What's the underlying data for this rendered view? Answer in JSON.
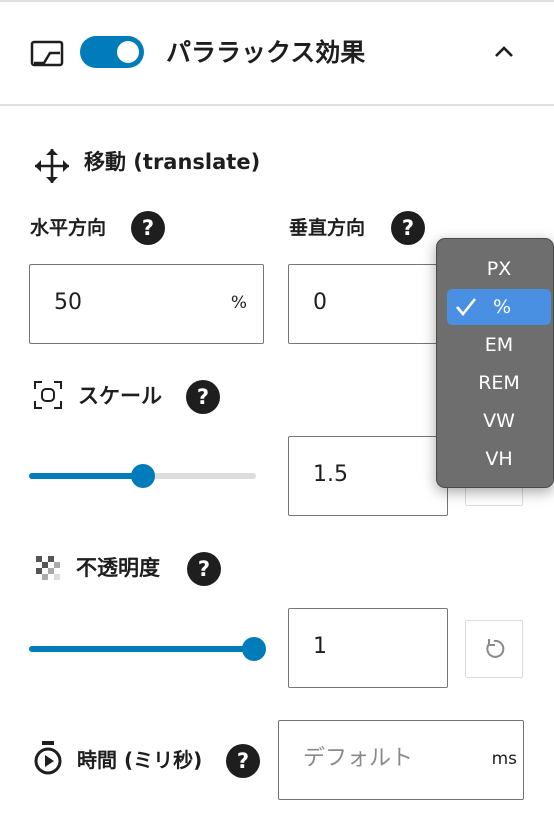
{
  "header": {
    "title": "パララックス効果",
    "toggle_on": true
  },
  "translate": {
    "title": "移動 (translate)",
    "horizontal": {
      "label": "水平方向",
      "value": "50",
      "unit": "%"
    },
    "vertical": {
      "label": "垂直方向",
      "value": "0"
    },
    "help_symbol": "?"
  },
  "unit_menu": {
    "options": [
      "PX",
      "%",
      "EM",
      "REM",
      "VW",
      "VH"
    ],
    "selected": "%"
  },
  "scale": {
    "label": "スケール",
    "value": "1.5",
    "slider_fraction": 0.5
  },
  "opacity": {
    "label": "不透明度",
    "value": "1",
    "slider_fraction": 1.0
  },
  "duration": {
    "label": "時間 (ミリ秒)",
    "placeholder": "デフォルト",
    "unit": "ms"
  },
  "colors": {
    "accent": "#007cba",
    "menu_bg": "#6e6e6e",
    "menu_selected": "#4a90e2"
  },
  "icons": [
    "panel-icon",
    "move-icon",
    "scale-icon",
    "opacity-icon",
    "stopwatch-icon",
    "chevron-up-icon",
    "reset-icon",
    "checkmark-icon"
  ]
}
